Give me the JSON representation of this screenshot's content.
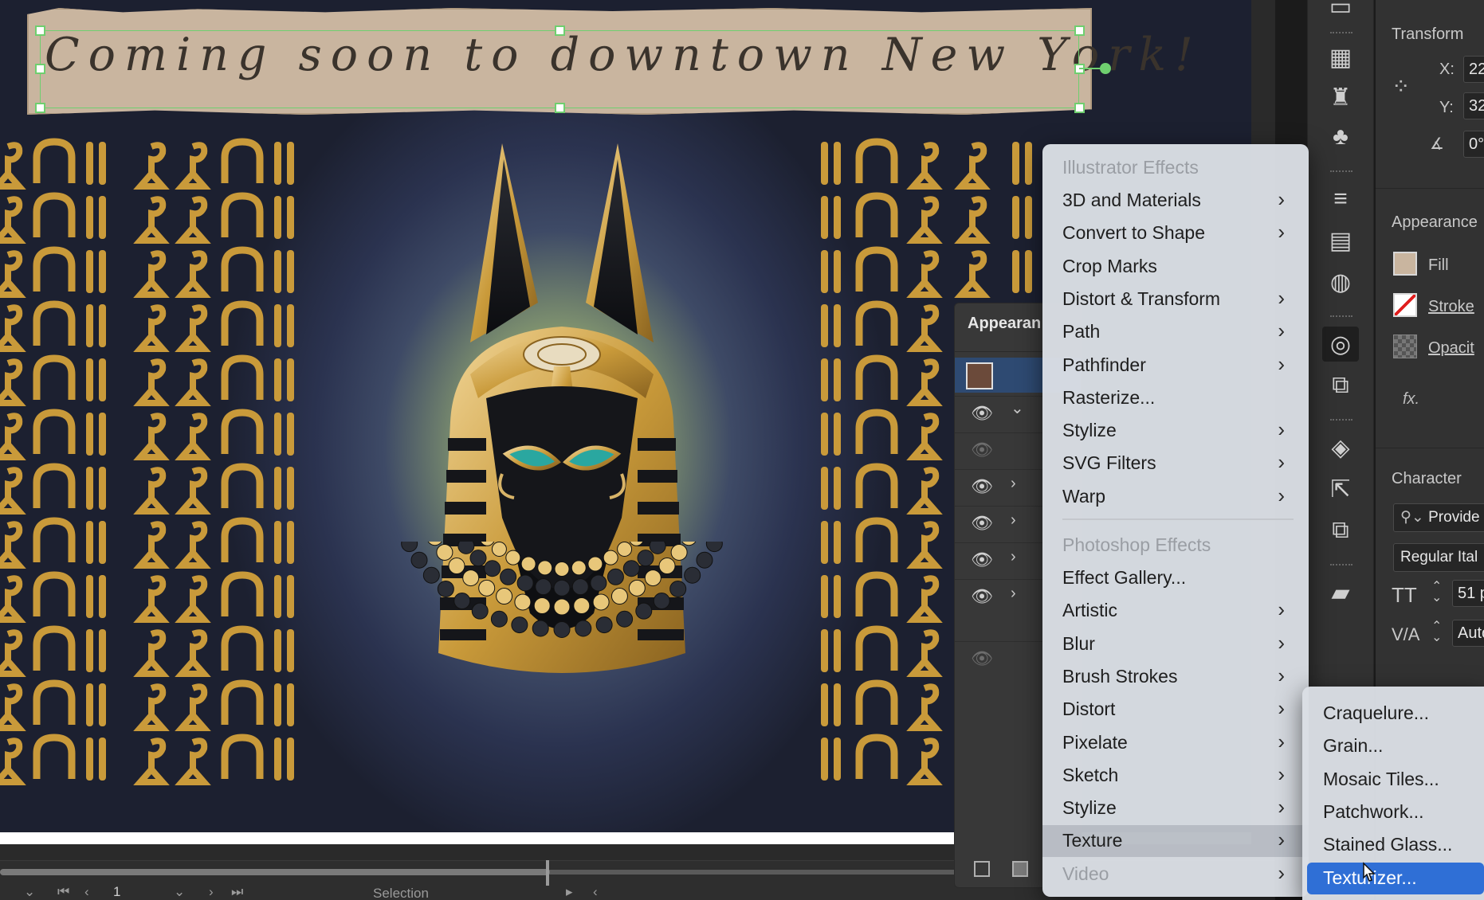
{
  "artwork": {
    "banner_text": "Coming soon to downtown New York!"
  },
  "status_bar": {
    "page_value": "1",
    "tool_label": "Selection"
  },
  "appearance_panel": {
    "title": "Appearan"
  },
  "properties": {
    "transform": {
      "heading": "Transform",
      "x_label": "X:",
      "x_value": "22",
      "y_label": "Y:",
      "y_value": "32",
      "angle_value": "0°"
    },
    "appearance": {
      "heading": "Appearance",
      "fill_label": "Fill",
      "stroke_label": "Stroke",
      "opacity_label": "Opacit",
      "fx_label": "fx."
    },
    "character": {
      "heading": "Character",
      "font_family": "Provide",
      "font_style": "Regular Ital",
      "font_size": "51 p",
      "tracking": "Auto"
    }
  },
  "effect_menu": {
    "illustrator_header": "Illustrator Effects",
    "illustrator_items": [
      {
        "label": "3D and Materials",
        "submenu": true
      },
      {
        "label": "Convert to Shape",
        "submenu": true
      },
      {
        "label": "Crop Marks",
        "submenu": false
      },
      {
        "label": "Distort & Transform",
        "submenu": true
      },
      {
        "label": "Path",
        "submenu": true
      },
      {
        "label": "Pathfinder",
        "submenu": true
      },
      {
        "label": "Rasterize...",
        "submenu": false
      },
      {
        "label": "Stylize",
        "submenu": true
      },
      {
        "label": "SVG Filters",
        "submenu": true
      },
      {
        "label": "Warp",
        "submenu": true
      }
    ],
    "photoshop_header": "Photoshop Effects",
    "photoshop_items": [
      {
        "label": "Effect Gallery...",
        "submenu": false
      },
      {
        "label": "Artistic",
        "submenu": true
      },
      {
        "label": "Blur",
        "submenu": true
      },
      {
        "label": "Brush Strokes",
        "submenu": true
      },
      {
        "label": "Distort",
        "submenu": true
      },
      {
        "label": "Pixelate",
        "submenu": true
      },
      {
        "label": "Sketch",
        "submenu": true
      },
      {
        "label": "Stylize",
        "submenu": true
      },
      {
        "label": "Texture",
        "submenu": true,
        "active": true
      },
      {
        "label": "Video",
        "submenu": true,
        "disabled": true
      }
    ],
    "arrow_glyph": "›"
  },
  "texture_submenu": {
    "items": [
      "Craquelure...",
      "Grain...",
      "Mosaic Tiles...",
      "Patchwork...",
      "Stained Glass...",
      "Texturizer..."
    ],
    "highlighted_index": 5
  },
  "colors": {
    "gold": "#c99a3a",
    "gold_light": "#e8c77a",
    "black_mask": "#15161a",
    "turquoise": "#2aa7a0",
    "selection_green": "#6fcf6f",
    "menu_highlight": "#2f6fd6"
  },
  "icons": {
    "eye": "👁",
    "chevron_right": "›",
    "chevron_down": "⌄"
  }
}
